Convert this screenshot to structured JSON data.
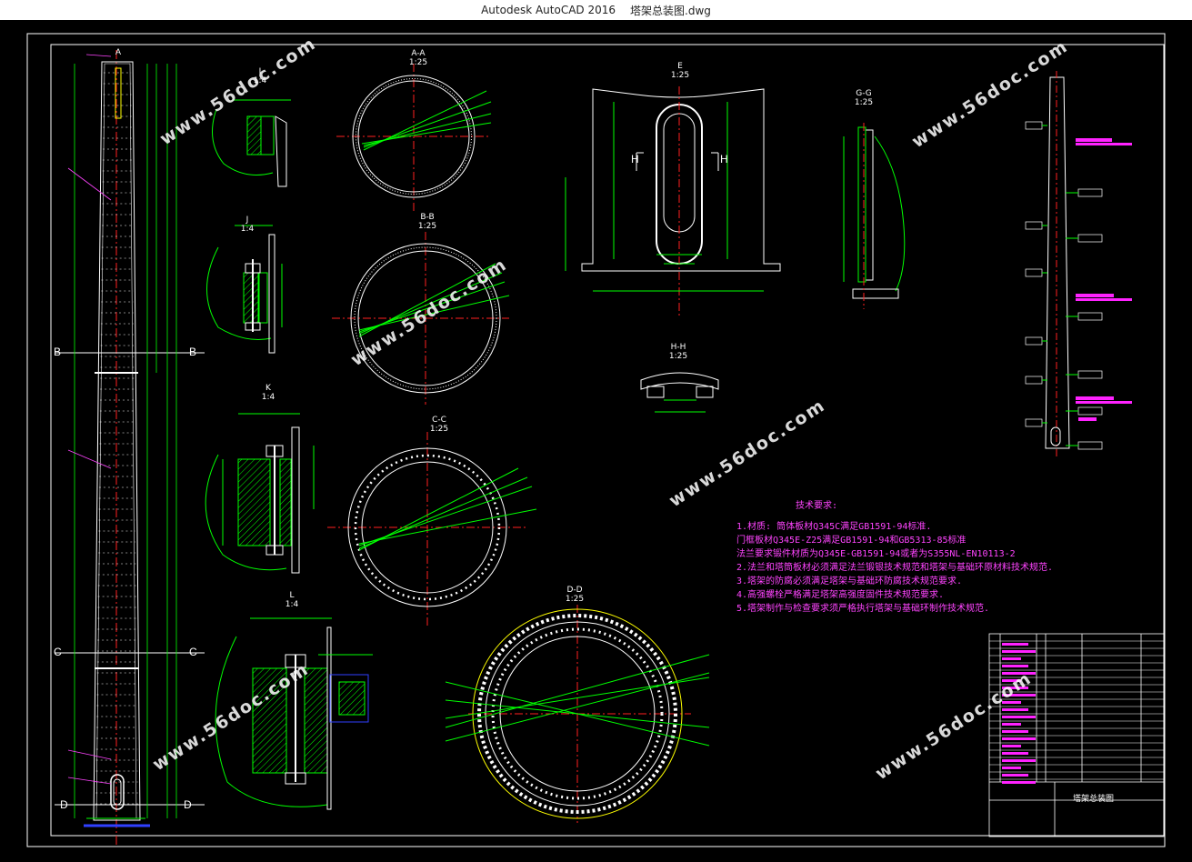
{
  "window": {
    "app": "Autodesk AutoCAD 2016",
    "file": "塔架总装图.dwg"
  },
  "views": {
    "I": {
      "name": "I",
      "scale": "1:4"
    },
    "J": {
      "name": "J",
      "scale": "1:4"
    },
    "K": {
      "name": "K",
      "scale": "1:4"
    },
    "L": {
      "name": "L",
      "scale": "1:4"
    },
    "AA": {
      "name": "A-A",
      "scale": "1:25"
    },
    "BB": {
      "name": "B-B",
      "scale": "1:25"
    },
    "CC": {
      "name": "C-C",
      "scale": "1:25"
    },
    "DD": {
      "name": "D-D",
      "scale": "1:25"
    },
    "E": {
      "name": "E",
      "scale": "1:25"
    },
    "GG": {
      "name": "G-G",
      "scale": "1:25"
    },
    "HH": {
      "name": "H-H",
      "scale": "1:25"
    }
  },
  "section_marks": {
    "A": "A",
    "B": "B",
    "C": "C",
    "D": "D",
    "H": "H"
  },
  "tech": {
    "title": "技术要求:",
    "lines": [
      "1.材质: 筒体板材Q345C满足GB1591-94标准.",
      "   门框板材Q345E-Z25满足GB1591-94和GB5313-85标准",
      "   法兰要求锻件材质为Q345E-GB1591-94或者为S355NL-EN10113-2",
      "2.法兰和塔筒板材必须满足法兰锻银技术规范和塔架与基础环原材料技术规范.",
      "3.塔架的防腐必须满足塔架与基础环防腐技术规范要求.",
      "4.高强螺栓严格满足塔架高强度固件技术规范要求.",
      "5.塔架制作与检查要求须严格执行塔架与基础环制作技术规范."
    ]
  },
  "title_block": {
    "drawing_name": "塔架总装图"
  },
  "watermark": "www.56doc.com",
  "colors": {
    "green": "#00ff00",
    "white": "#ffffff",
    "red": "#ff2020",
    "magenta": "#ff44ff",
    "yellow": "#ffff00",
    "blue": "#3040ff"
  }
}
